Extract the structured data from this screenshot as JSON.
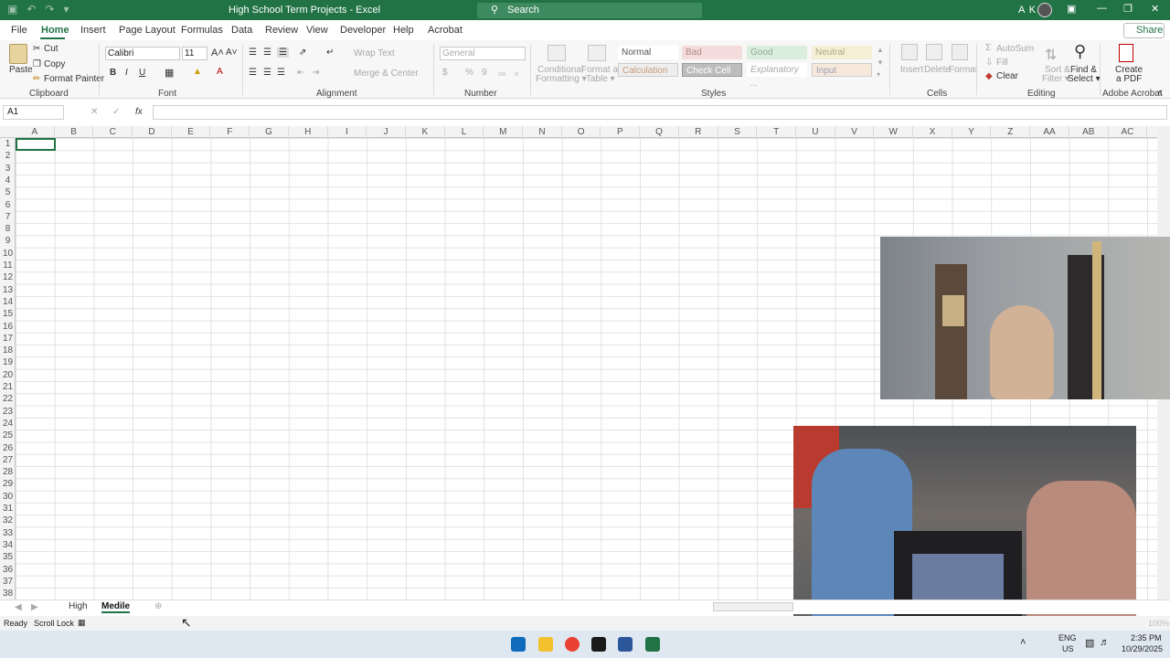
{
  "titlebar": {
    "title": "High School Term Projects - Excel",
    "search_placeholder": "Search",
    "user_initials": "A K",
    "qat": [
      "▣",
      "↶",
      "↷",
      "▾"
    ]
  },
  "tabs": [
    "File",
    "Home",
    "Insert",
    "Page Layout",
    "Formulas",
    "Data",
    "Review",
    "View",
    "Developer",
    "Help",
    "Acrobat"
  ],
  "share_label": "Share",
  "clipboard": {
    "paste": "Paste",
    "cut": "Cut",
    "copy": "Copy",
    "format_painter": "Format Painter",
    "label": "Clipboard"
  },
  "font": {
    "name": "Calibri",
    "size": "11",
    "bold": "B",
    "italic": "I",
    "underline": "U",
    "label": "Font"
  },
  "alignment": {
    "wrap_text": "Wrap Text",
    "merge_center": "Merge & Center",
    "label": "Alignment"
  },
  "number": {
    "format": "General",
    "currency": "$",
    "percent": "%",
    "comma": "9",
    "label": "Number"
  },
  "styles": {
    "conditional_formatting": [
      "Conditional",
      "Formatting ▾"
    ],
    "format_as_table": [
      "Format as",
      "Table ▾"
    ],
    "cells": [
      "Normal",
      "Bad",
      "Good",
      "Neutral",
      "Calculation",
      "Check Cell",
      "Explanatory ...",
      "Input"
    ],
    "label": "Styles"
  },
  "cells_group": {
    "insert": "Insert",
    "delete": "Delete",
    "format": "Format",
    "label": "Cells"
  },
  "editing": {
    "autosum": "AutoSum",
    "fill": "Fill",
    "clear": "Clear",
    "sort_filter": [
      "Sort &",
      "Filter ▾"
    ],
    "find_select": [
      "Find &",
      "Select ▾"
    ],
    "label": "Editing"
  },
  "acrobat": {
    "create_pdf": [
      "Create",
      "a PDF"
    ],
    "label": "Adobe Acrobat"
  },
  "formula_bar": {
    "name_box": "A1",
    "fx": "fx",
    "cancel": "✕",
    "enter": "✓",
    "value": ""
  },
  "columns": [
    "A",
    "B",
    "C",
    "D",
    "E",
    "F",
    "G",
    "H",
    "I",
    "J",
    "K",
    "L",
    "M",
    "N",
    "O",
    "P",
    "Q",
    "R",
    "S",
    "T",
    "U",
    "V",
    "W",
    "X",
    "Y",
    "Z",
    "AA",
    "AB",
    "AC"
  ],
  "rows": [
    "1",
    "2",
    "3",
    "4",
    "5",
    "6",
    "7",
    "8",
    "9",
    "10",
    "11",
    "12",
    "13",
    "14",
    "15",
    "16",
    "17",
    "18",
    "19",
    "20",
    "21",
    "22",
    "23",
    "24",
    "25",
    "26",
    "27",
    "28",
    "29",
    "30",
    "31",
    "32",
    "33",
    "34",
    "35",
    "36",
    "37",
    "38"
  ],
  "sheets": [
    "High",
    "Medile"
  ],
  "status": {
    "ready": "Ready",
    "scroll_lock": "Scroll Lock",
    "zoom": "100%"
  },
  "taskbar": {
    "lang": "ENG",
    "region": "US",
    "time": "2:35 PM",
    "date": "10/29/2025"
  },
  "colors": {
    "accent": "#217346",
    "search_bg": "#3e8a60",
    "taskbar": "#dfe8f0"
  }
}
